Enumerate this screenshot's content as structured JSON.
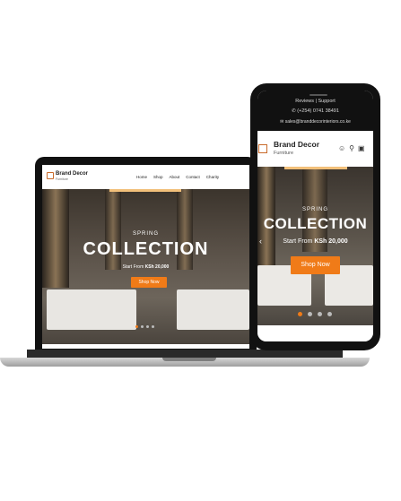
{
  "laptop": {
    "brand": "Brand Decor",
    "brand_sub": "Furniture",
    "nav": [
      "Home",
      "Shop",
      "About",
      "Contact",
      "Charity"
    ],
    "hero": {
      "season": "SPRING",
      "title": "COLLECTION",
      "price_prefix": "Start From ",
      "price": "KSh 20,000",
      "button": "Shop Now"
    }
  },
  "phone": {
    "top_links": "Reviews  |  Support",
    "phone": "(+254) 0741 38491",
    "email": "sales@branddecorinteriors.co.ke",
    "brand": "Brand Decor",
    "brand_sub": "Furniture",
    "hero": {
      "season": "SPRING",
      "title": "COLLECTION",
      "price_prefix": "Start From ",
      "price": "KSh 20,000",
      "button": "Shop Now"
    }
  },
  "colors": {
    "accent": "#f07b18",
    "dark": "#111111"
  },
  "icons": [
    "user-icon",
    "search-icon",
    "cart-icon",
    "chevron-left-icon",
    "envelope-icon",
    "phone-icon"
  ]
}
